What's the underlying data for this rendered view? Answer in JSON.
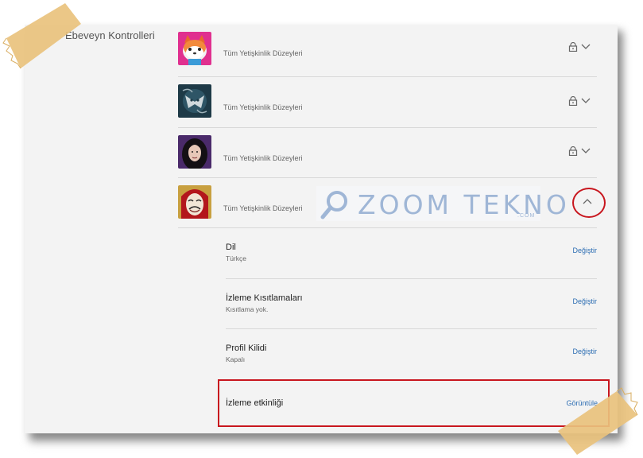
{
  "section": {
    "title": "Ebeveyn Kontrolleri"
  },
  "profiles": [
    {
      "maturity": "Tüm Yetişkinlik Düzeyleri",
      "avatar": "red-panda-avatar",
      "expanded": false
    },
    {
      "maturity": "Tüm Yetişkinlik Düzeyleri",
      "avatar": "witcher-medallion-avatar",
      "expanded": false
    },
    {
      "maturity": "Tüm Yetişkinlik Düzeyleri",
      "avatar": "dark-haired-woman-avatar",
      "expanded": false
    },
    {
      "maturity": "Tüm Yetişkinlik Düzeyleri",
      "avatar": "dali-mask-avatar",
      "expanded": true
    }
  ],
  "settings": [
    {
      "title": "Dil",
      "value": "Türkçe",
      "action": "Değiştir"
    },
    {
      "title": "İzleme Kısıtlamaları",
      "value": "Kısıtlama yok.",
      "action": "Değiştir"
    },
    {
      "title": "Profil Kilidi",
      "value": "Kapalı",
      "action": "Değiştir"
    }
  ],
  "activity": {
    "title": "İzleme etkinliği",
    "action": "Görüntüle"
  },
  "watermark": {
    "text": "ZOOM TEKNO",
    "sub": ".COM"
  },
  "colors": {
    "link": "#2d6eb3",
    "highlight": "#c8161e",
    "panel": "#f3f3f3"
  }
}
